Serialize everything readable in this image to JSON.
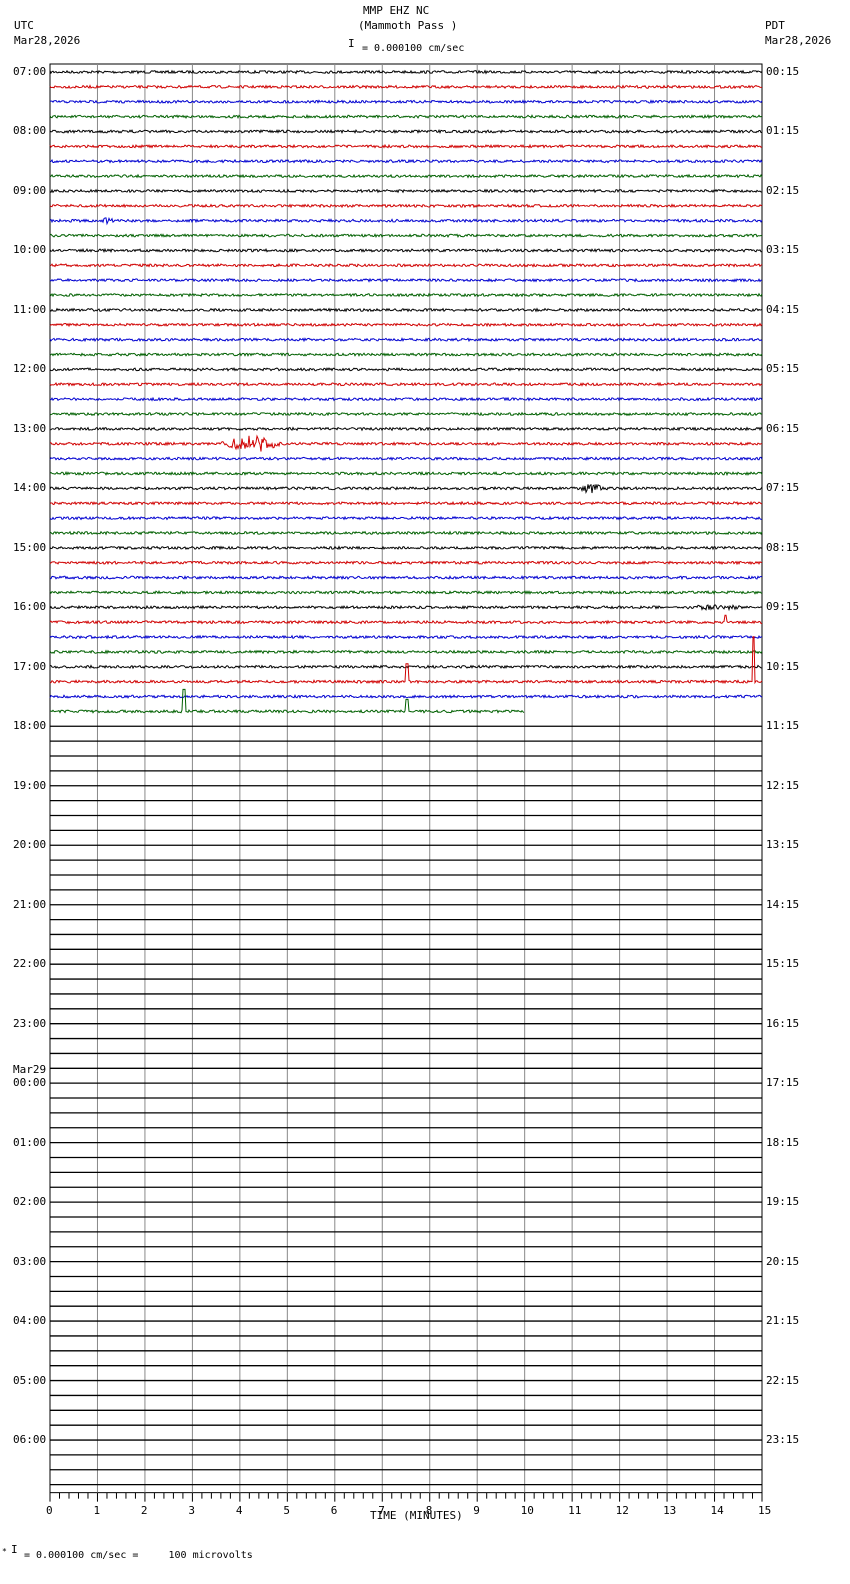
{
  "header": {
    "station": "MMP EHZ NC",
    "location": "(Mammoth Pass )",
    "scale": "= 0.000100 cm/sec",
    "left_tz": "UTC",
    "left_date": "Mar28,2026",
    "right_tz": "PDT",
    "right_date": "Mar28,2026"
  },
  "footer": {
    "scale_note": "= 0.000100 cm/sec =     100 microvolts"
  },
  "chart_data": {
    "type": "line",
    "title": "MMP EHZ NC (Mammoth Pass )",
    "xlabel": "TIME (MINUTES)",
    "xlim": [
      0,
      15
    ],
    "x_ticks": [
      "0",
      "1",
      "2",
      "3",
      "4",
      "5",
      "6",
      "7",
      "8",
      "9",
      "10",
      "11",
      "12",
      "13",
      "14",
      "15"
    ],
    "rows_total": 96,
    "rows_per_hour": 4,
    "rows_with_data": 43,
    "last_row_minutes": 10,
    "trace_colors": [
      "#000000",
      "#d00000",
      "#0000d0",
      "#006000"
    ],
    "left_labels": [
      "07:00",
      "08:00",
      "09:00",
      "10:00",
      "11:00",
      "12:00",
      "13:00",
      "14:00",
      "15:00",
      "16:00",
      "17:00",
      "18:00",
      "19:00",
      "20:00",
      "21:00",
      "22:00",
      "23:00",
      "00:00",
      "01:00",
      "02:00",
      "03:00",
      "04:00",
      "05:00",
      "06:00"
    ],
    "date_change_label": "Mar29",
    "right_labels": [
      "00:15",
      "01:15",
      "02:15",
      "03:15",
      "04:15",
      "05:15",
      "06:15",
      "07:15",
      "08:15",
      "09:15",
      "10:15",
      "11:15",
      "12:15",
      "13:15",
      "14:15",
      "15:15",
      "16:15",
      "17:15",
      "18:15",
      "19:15",
      "20:15",
      "21:15",
      "22:15",
      "23:15"
    ],
    "events": [
      {
        "row": 10,
        "start_min": 1.0,
        "end_min": 1.4,
        "amplitude": 3
      },
      {
        "row": 25,
        "start_min": 3.6,
        "end_min": 4.9,
        "amplitude": 9
      },
      {
        "row": 28,
        "start_min": 11.1,
        "end_min": 11.7,
        "amplitude": 5
      },
      {
        "row": 36,
        "start_min": 13.0,
        "end_min": 15.0,
        "amplitude": 2.5
      },
      {
        "row": 37,
        "start_min": 14.2,
        "end_min": 14.25,
        "amplitude": 7,
        "spike": true
      },
      {
        "row": 41,
        "start_min": 14.8,
        "end_min": 14.85,
        "amplitude": 45,
        "spike": true
      },
      {
        "row": 41,
        "start_min": 7.5,
        "end_min": 7.55,
        "amplitude": 18,
        "spike": true
      },
      {
        "row": 43,
        "start_min": 2.8,
        "end_min": 2.85,
        "amplitude": 22,
        "spike": true
      },
      {
        "row": 43,
        "start_min": 7.5,
        "end_min": 7.55,
        "amplitude": 12,
        "spike": true
      }
    ]
  }
}
